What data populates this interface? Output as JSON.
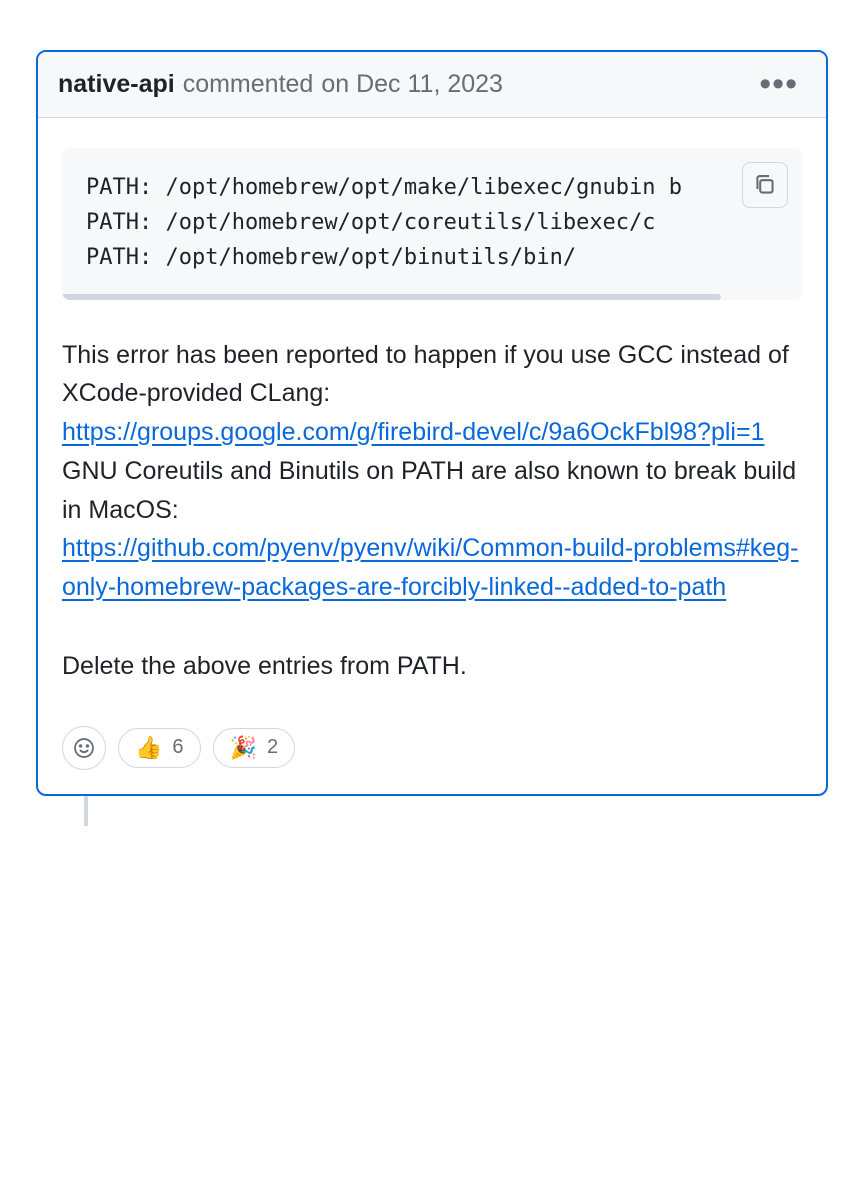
{
  "header": {
    "author": "native-api",
    "action": "commented",
    "on": "on Dec 11, 2023"
  },
  "code": {
    "line1": "PATH: /opt/homebrew/opt/make/libexec/gnubin b",
    "line2": "PATH: /opt/homebrew/opt/coreutils/libexec/c",
    "line3": "PATH: /opt/homebrew/opt/binutils/bin/"
  },
  "body": {
    "p1": "This error has been reported to happen if you use GCC instead of XCode-provided CLang:",
    "link1": "https://groups.google.com/g/firebird-devel/c/9a6OckFbl98?pli=1",
    "p2": "GNU Coreutils and Binutils on PATH are also known to break build in MacOS:",
    "link2": "https://github.com/pyenv/pyenv/wiki/Common-build-problems#keg-only-homebrew-packages-are-forcibly-linked--added-to-path",
    "p3": "Delete the above entries from PATH."
  },
  "reactions": {
    "thumbsup": {
      "emoji": "👍",
      "count": "6"
    },
    "tada": {
      "emoji": "🎉",
      "count": "2"
    }
  }
}
